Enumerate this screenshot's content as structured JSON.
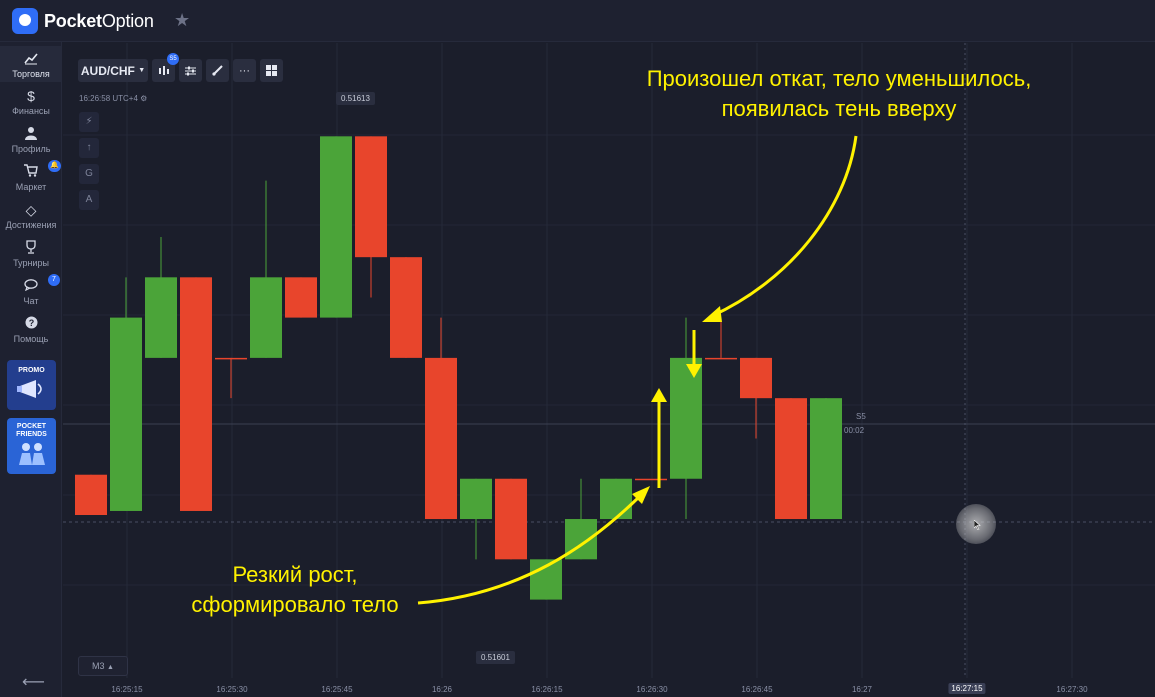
{
  "app": {
    "brand_bold": "Pocket",
    "brand_light": "Option"
  },
  "sidebar": {
    "items": [
      {
        "label": "Торговля",
        "icon": "chart-line-icon",
        "active": true
      },
      {
        "label": "Финансы",
        "icon": "dollar-icon"
      },
      {
        "label": "Профиль",
        "icon": "user-icon"
      },
      {
        "label": "Маркет",
        "icon": "cart-icon",
        "badge": ""
      },
      {
        "label": "Достижения",
        "icon": "diamond-icon"
      },
      {
        "label": "Турниры",
        "icon": "trophy-icon"
      },
      {
        "label": "Чат",
        "icon": "chat-icon",
        "badge": "7"
      },
      {
        "label": "Помощь",
        "icon": "help-icon"
      }
    ],
    "promo_label": "PROMO",
    "friends_label_1": "POCKET",
    "friends_label_2": "FRIENDS"
  },
  "toolbar": {
    "pair": "AUD/CHF",
    "candle_badge": "S5",
    "timestamp": "16:26:58 UTC+4",
    "timeframe": "M3"
  },
  "drawing_tools": [
    "⚡",
    "↑",
    "G",
    "A"
  ],
  "chart": {
    "price_high": "0.51613",
    "price_low": "0.51601",
    "current_period": "S5",
    "countdown": "00:02",
    "x_ticks": [
      "16:25:15",
      "16:25:30",
      "16:25:45",
      "16:26",
      "16:26:15",
      "16:26:30",
      "16:26:45",
      "16:27",
      "16:27:15",
      "16:27:30"
    ],
    "highlight_tick": "16:27:15",
    "colors": {
      "up": "#4ba439",
      "down": "#e8452c",
      "annotation": "#fff200",
      "background": "#1b1e2b"
    }
  },
  "annotations": {
    "top_line1": "Произошел откат, тело уменьшилось,",
    "top_line2": "появилась тень вверху",
    "bottom_line1": "Резкий рост,",
    "bottom_line2": "сформировало тело"
  },
  "chart_data": {
    "type": "candlestick",
    "ylim": [
      0.516,
      0.51614
    ],
    "candles": [
      {
        "dir": "down",
        "open": 0.516045,
        "close": 0.516035,
        "high": 0.516045,
        "low": 0.516035
      },
      {
        "dir": "up",
        "open": 0.516036,
        "close": 0.516084,
        "high": 0.516094,
        "low": 0.516036
      },
      {
        "dir": "up",
        "open": 0.516074,
        "close": 0.516094,
        "high": 0.516104,
        "low": 0.516074
      },
      {
        "dir": "down",
        "open": 0.516094,
        "close": 0.516036,
        "high": 0.516094,
        "low": 0.516036
      },
      {
        "dir": "flat",
        "open": 0.516074,
        "close": 0.516074,
        "high": 0.516074,
        "low": 0.516064
      },
      {
        "dir": "up",
        "open": 0.516074,
        "close": 0.516094,
        "high": 0.516118,
        "low": 0.516074
      },
      {
        "dir": "down",
        "open": 0.516094,
        "close": 0.516084,
        "high": 0.516094,
        "low": 0.516084
      },
      {
        "dir": "up",
        "open": 0.516084,
        "close": 0.516129,
        "high": 0.516129,
        "low": 0.516084
      },
      {
        "dir": "down",
        "open": 0.516129,
        "close": 0.516099,
        "high": 0.516129,
        "low": 0.516089
      },
      {
        "dir": "down",
        "open": 0.516099,
        "close": 0.516074,
        "high": 0.516099,
        "low": 0.516074
      },
      {
        "dir": "down",
        "open": 0.516074,
        "close": 0.516034,
        "high": 0.516084,
        "low": 0.516034
      },
      {
        "dir": "up",
        "open": 0.516034,
        "close": 0.516044,
        "high": 0.516044,
        "low": 0.516024
      },
      {
        "dir": "down",
        "open": 0.516044,
        "close": 0.516024,
        "high": 0.516044,
        "low": 0.516024
      },
      {
        "dir": "up",
        "open": 0.516014,
        "close": 0.516024,
        "high": 0.516024,
        "low": 0.516014
      },
      {
        "dir": "up",
        "open": 0.516024,
        "close": 0.516034,
        "high": 0.516044,
        "low": 0.516024
      },
      {
        "dir": "up",
        "open": 0.516034,
        "close": 0.516044,
        "high": 0.516044,
        "low": 0.516034
      },
      {
        "dir": "flat",
        "open": 0.516044,
        "close": 0.516044,
        "high": 0.516044,
        "low": 0.516044
      },
      {
        "dir": "up",
        "open": 0.516044,
        "close": 0.516074,
        "high": 0.516084,
        "low": 0.516034
      },
      {
        "dir": "flat",
        "open": 0.516074,
        "close": 0.516074,
        "high": 0.516084,
        "low": 0.516074
      },
      {
        "dir": "down",
        "open": 0.516074,
        "close": 0.516064,
        "high": 0.516074,
        "low": 0.516054
      },
      {
        "dir": "down",
        "open": 0.516064,
        "close": 0.516034,
        "high": 0.516064,
        "low": 0.516034
      },
      {
        "dir": "up",
        "open": 0.516034,
        "close": 0.516064,
        "high": 0.516064,
        "low": 0.516034
      }
    ]
  }
}
